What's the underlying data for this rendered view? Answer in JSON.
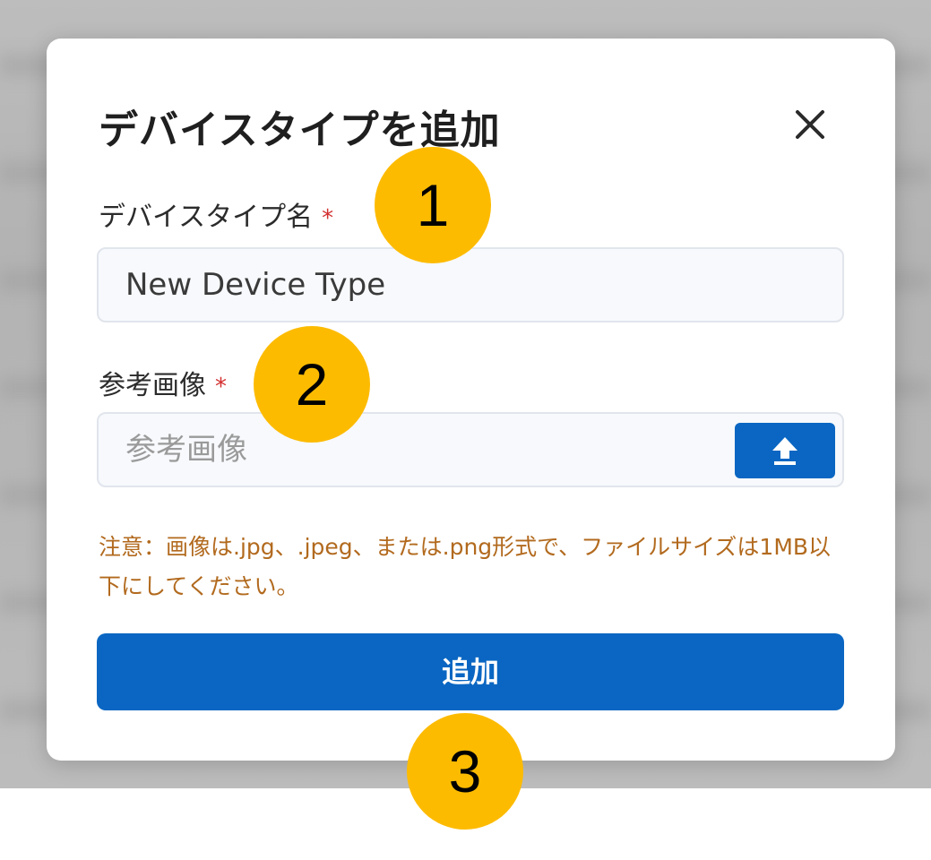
{
  "dialog": {
    "title": "デバイスタイプを追加",
    "close_icon": "close-icon"
  },
  "fields": {
    "device_type_name": {
      "label": "デバイスタイプ名",
      "required_mark": "*",
      "value": "New Device Type"
    },
    "reference_image": {
      "label": "参考画像",
      "required_mark": "*",
      "placeholder": "参考画像",
      "upload_icon": "upload-icon"
    }
  },
  "note": "注意：画像は.jpg、.jpeg、または.png形式で、ファイルサイズは1MB以下にしてください。",
  "submit_label": "追加",
  "annotations": [
    "1",
    "2",
    "3"
  ],
  "colors": {
    "primary": "#0a66c2",
    "required": "#d32f2f",
    "note": "#b26a1e",
    "marker": "#fdbb00"
  }
}
